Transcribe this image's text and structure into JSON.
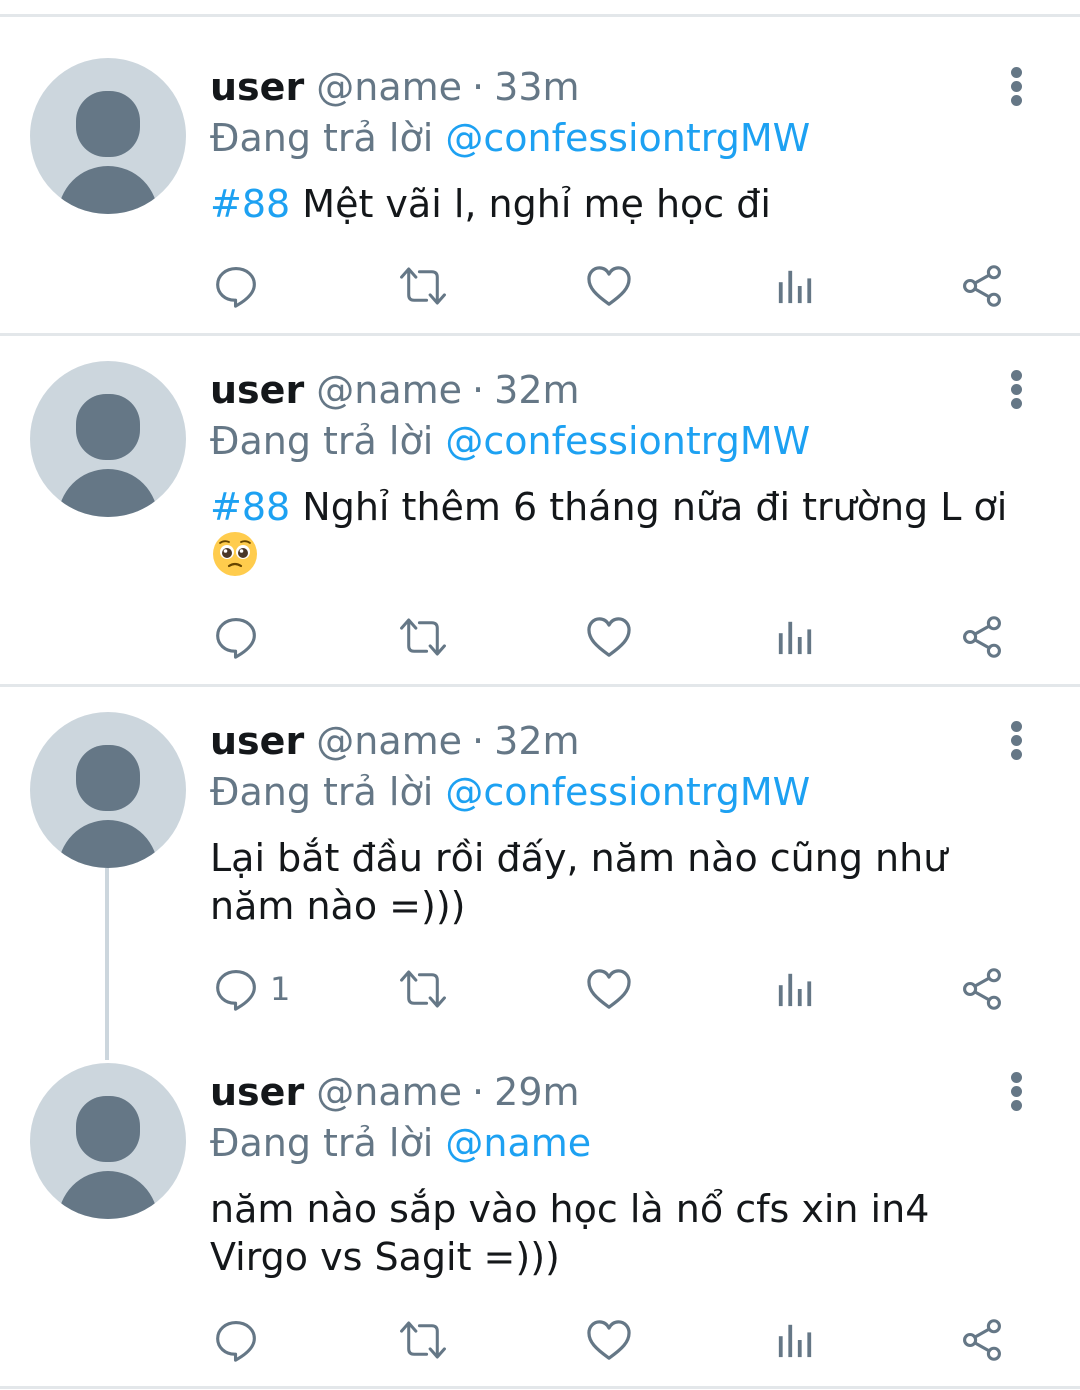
{
  "tweets": [
    {
      "user": "user",
      "handle": "@name",
      "separator": "·",
      "time": "33m",
      "reply_prefix": "Đang trả lời",
      "reply_to": "@confessiontrgMW",
      "hashtag": "#88",
      "text": " Mệt vãi l, nghỉ mẹ học đi",
      "reply_count": ""
    },
    {
      "user": "user",
      "handle": "@name",
      "separator": "·",
      "time": "32m",
      "reply_prefix": "Đang trả lời",
      "reply_to": "@confessiontrgMW",
      "hashtag": "#88",
      "text": " Nghỉ thêm 6 tháng nữa đi trường L ơi",
      "emoji": "pleading-face-emoji",
      "reply_count": ""
    },
    {
      "user": "user",
      "handle": "@name",
      "separator": "·",
      "time": "32m",
      "reply_prefix": "Đang trả lời",
      "reply_to": "@confessiontrgMW",
      "text": "Lại bắt đầu rồi đấy, năm nào cũng như năm nào =)))",
      "reply_count": "1"
    },
    {
      "user": "user",
      "handle": "@name",
      "separator": "·",
      "time": "29m",
      "reply_prefix": "Đang trả lời",
      "reply_to": "@name",
      "text": "năm nào sắp vào học là nổ cfs xin in4 Virgo vs Sagit =)))",
      "reply_count": ""
    }
  ],
  "icons": {
    "reply": "reply-icon",
    "retweet": "retweet-icon",
    "like": "heart-icon",
    "analytics": "analytics-icon",
    "share": "share-icon",
    "more": "more-vertical-icon"
  },
  "colors": {
    "accent": "#1da1f2",
    "muted": "#657786",
    "avatar_bg": "#ccd6dd",
    "divider": "#e3e7ea"
  }
}
